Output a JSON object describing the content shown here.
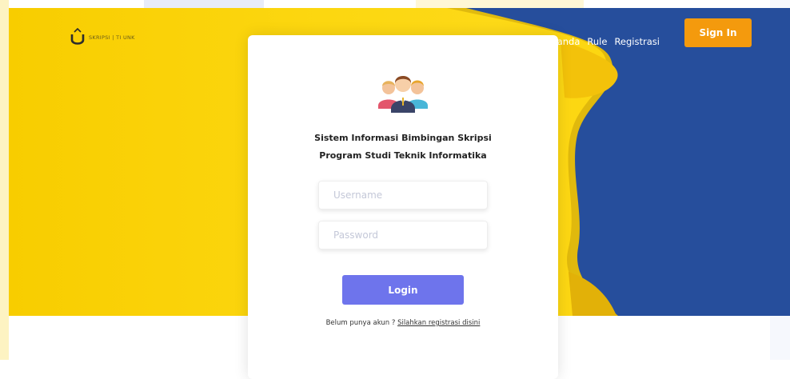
{
  "header": {
    "logo_text": "SKRIPSI | TI UNK",
    "nav": [
      {
        "label": "Beranda"
      },
      {
        "label": "Rule"
      },
      {
        "label": "Registrasi"
      }
    ],
    "signin_label": "Sign In"
  },
  "login_card": {
    "title_line1": "Sistem Informasi Bimbingan Skripsi",
    "title_line2": "Program Studi Teknik Informatika",
    "username_placeholder": "Username",
    "password_placeholder": "Password",
    "login_label": "Login",
    "register_prompt": "Belum punya akun ?",
    "register_link": "Silahkan registrasi disini"
  },
  "colors": {
    "hero_yellow": "#fcd710",
    "hero_blue": "#264e9c",
    "signin_orange": "#f49a0d",
    "login_purple": "#6e74ec"
  },
  "icons": [
    "logo-icon",
    "users-group-icon"
  ]
}
